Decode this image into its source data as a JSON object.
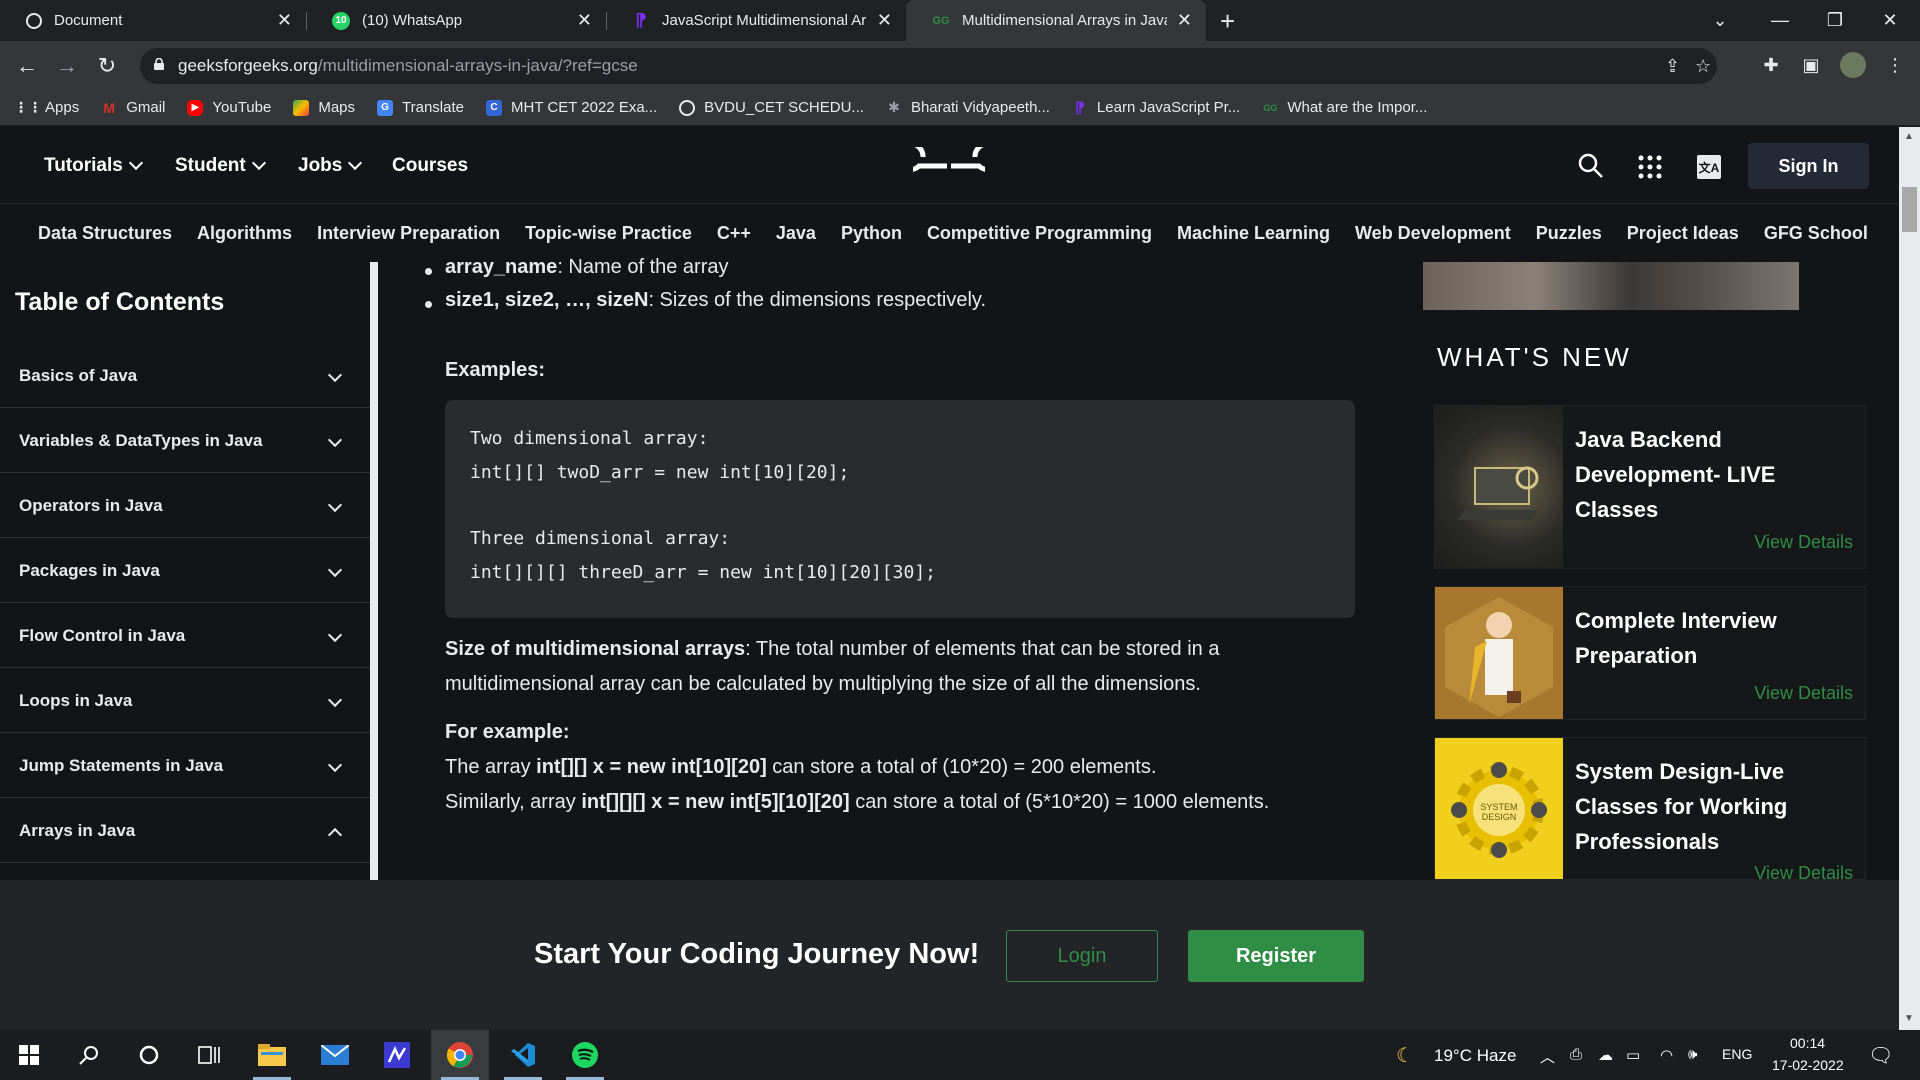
{
  "browser": {
    "tabs": [
      {
        "title": "Document",
        "icon": "globe-icon",
        "active": false
      },
      {
        "title": "(10) WhatsApp",
        "icon": "whatsapp-icon",
        "active": false
      },
      {
        "title": "JavaScript Multidimensional Arra",
        "icon": "learn-js-icon",
        "active": false
      },
      {
        "title": "Multidimensional Arrays in Java -",
        "icon": "gfg-icon",
        "active": true
      }
    ],
    "new_tab": "+",
    "url_host": "geeksforgeeks.org",
    "url_path": "/multidimensional-arrays-in-java/?ref=gcse",
    "bookmarks": [
      {
        "label": "Apps",
        "icon": "apps-grid-icon",
        "color": "#e8eaed"
      },
      {
        "label": "Gmail",
        "icon": "gmail-icon",
        "color": "#d93025"
      },
      {
        "label": "YouTube",
        "icon": "youtube-icon",
        "color": "#ff0000"
      },
      {
        "label": "Maps",
        "icon": "maps-icon",
        "color": "#34a853"
      },
      {
        "label": "Translate",
        "icon": "translate-icon",
        "color": "#4285f4"
      },
      {
        "label": "MHT CET 2022 Exa...",
        "icon": "c-icon",
        "color": "#3367d6"
      },
      {
        "label": "BVDU_CET SCHEDU...",
        "icon": "bvdu-icon",
        "color": "#e8eaed"
      },
      {
        "label": "Bharati Vidyapeeth...",
        "icon": "bharati-icon",
        "color": "#9aa0a6"
      },
      {
        "label": "Learn JavaScript Pr...",
        "icon": "learn-js-icon",
        "color": "#7b2ff7"
      },
      {
        "label": "What are the Impor...",
        "icon": "gfg-icon",
        "color": "#2f8d46"
      }
    ]
  },
  "header": {
    "nav": [
      "Tutorials",
      "Student",
      "Jobs",
      "Courses"
    ],
    "sign_in": "Sign In",
    "subnav": [
      "Data Structures",
      "Algorithms",
      "Interview Preparation",
      "Topic-wise Practice",
      "C++",
      "Java",
      "Python",
      "Competitive Programming",
      "Machine Learning",
      "Web Development",
      "Puzzles",
      "Project Ideas",
      "GFG School"
    ]
  },
  "toc": {
    "title": "Table of Contents",
    "items": [
      {
        "label": "Basics of Java",
        "expanded": false
      },
      {
        "label": "Variables & DataTypes in Java",
        "expanded": false
      },
      {
        "label": "Operators in Java",
        "expanded": false
      },
      {
        "label": "Packages in Java",
        "expanded": false
      },
      {
        "label": "Flow Control in Java",
        "expanded": false
      },
      {
        "label": "Loops in Java",
        "expanded": false
      },
      {
        "label": "Jump Statements in Java",
        "expanded": false
      },
      {
        "label": "Arrays in Java",
        "expanded": true
      }
    ]
  },
  "article": {
    "bullet1_term": "array_name",
    "bullet1_text": ": Name of the array",
    "bullet2_term": "size1, size2, …, sizeN",
    "bullet2_text": ": Sizes of the dimensions respectively.",
    "examples_heading": "Examples:",
    "code": [
      "Two dimensional array:",
      "int[][] twoD_arr = new int[10][20];",
      "",
      "Three dimensional array:",
      "int[][][] threeD_arr = new int[10][20][30];"
    ],
    "size_term": "Size of multidimensional arrays",
    "size_text": ": The total number of elements that can be stored in a multidimensional array can be calculated by multiplying the size of all the dimensions.",
    "for_example": "For example:",
    "ex1_a": "The array ",
    "ex1_b": "int[][] x = new int[10][20]",
    "ex1_c": " can store a total of (10*20) = 200 elements.",
    "ex2_a": "Similarly, array ",
    "ex2_b": "int[][][] x = new int[5][10][20]",
    "ex2_c": " can store a total of (5*10*20) = 1000 elements."
  },
  "whats_new": {
    "title": "WHAT'S NEW",
    "cards": [
      {
        "title": "Java Backend Development- LIVE Classes",
        "link": "View Details"
      },
      {
        "title": "Complete Interview Preparation",
        "link": "View Details"
      },
      {
        "title": "System Design-Live Classes for Working Professionals",
        "link": "View Details",
        "thumb_text": "SYSTEM DESIGN"
      }
    ]
  },
  "banner": {
    "cta": "Start Your Coding Journey Now!",
    "login": "Login",
    "register": "Register"
  },
  "taskbar": {
    "weather": "19°C  Haze",
    "lang": "ENG",
    "time": "00:14",
    "date": "17-02-2022"
  },
  "colors": {
    "gfg_green": "#2f8d46",
    "page_bg": "#131417",
    "code_bg": "#2a2b2e"
  }
}
